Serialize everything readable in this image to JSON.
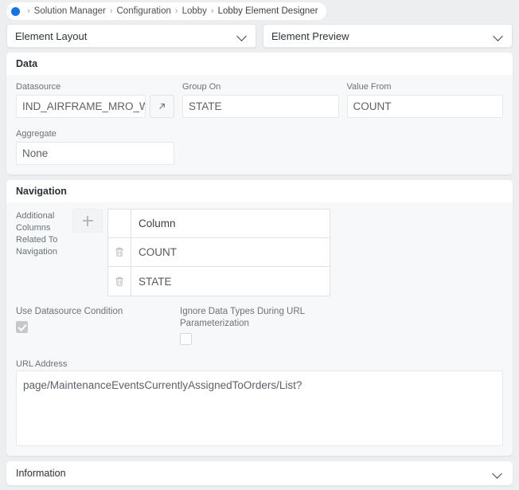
{
  "breadcrumb": {
    "home_icon": "blue-dot-icon",
    "separator": "›",
    "items": [
      {
        "label": "Solution Manager"
      },
      {
        "label": "Configuration"
      },
      {
        "label": "Lobby"
      },
      {
        "label": "Lobby Element Designer"
      }
    ]
  },
  "selects": [
    {
      "label": "Element Layout",
      "icon": "chevron-down-icon"
    },
    {
      "label": "Element Preview",
      "icon": "chevron-down-icon"
    }
  ],
  "data_section": {
    "title": "Data",
    "datasource": {
      "label": "Datasource",
      "value": "IND_AIRFRAME_MRO_W",
      "button_icon": "open-external-icon"
    },
    "group_on": {
      "label": "Group On",
      "value": "STATE"
    },
    "value_from": {
      "label": "Value From",
      "value": "COUNT"
    },
    "aggregate": {
      "label": "Aggregate",
      "value": "None"
    }
  },
  "navigation_section": {
    "title": "Navigation",
    "additional_columns_label": "Additional Columns Related To Navigation",
    "add_button_icon": "plus-icon",
    "table": {
      "header": [
        "",
        "Column"
      ],
      "rows": [
        {
          "delete_icon": "trash-icon",
          "column": "COUNT"
        },
        {
          "delete_icon": "trash-icon",
          "column": "STATE"
        }
      ]
    },
    "use_datasource_condition": {
      "label": "Use Datasource Condition",
      "checked": true
    },
    "ignore_data_types": {
      "label": "Ignore Data Types During URL Parameterization",
      "checked": false
    },
    "url_address": {
      "label": "URL Address",
      "value": "page/MaintenanceEventsCurrentlyAssignedToOrders/List?"
    }
  },
  "information_section": {
    "title": "Information",
    "icon": "chevron-down-icon"
  },
  "colors": {
    "accent": "#1473e6",
    "page_bg": "#eceef0",
    "card_bg": "#f7f8f9",
    "text": "#2b3035",
    "muted": "#6b7278"
  }
}
